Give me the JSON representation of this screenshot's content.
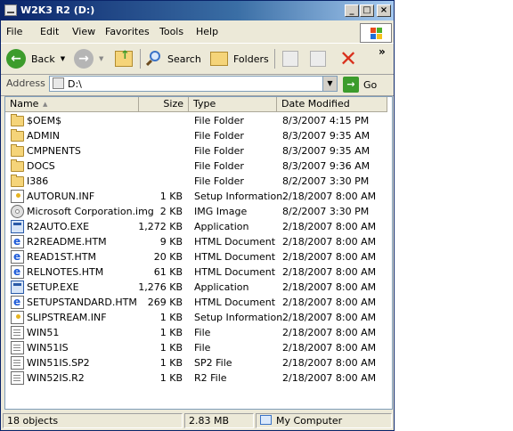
{
  "window": {
    "title": "W2K3 R2 (D:)"
  },
  "menu": [
    {
      "label": "File"
    },
    {
      "label": "Edit"
    },
    {
      "label": "View"
    },
    {
      "label": "Favorites"
    },
    {
      "label": "Tools"
    },
    {
      "label": "Help"
    }
  ],
  "toolbar": {
    "back": "Back",
    "search": "Search",
    "folders": "Folders",
    "overflow": "»"
  },
  "address": {
    "label": "Address",
    "value": "D:\\",
    "go": "Go"
  },
  "columns": {
    "name": "Name",
    "size": "Size",
    "type": "Type",
    "date": "Date Modified"
  },
  "files": [
    {
      "name": "$OEM$",
      "size": "",
      "type": "File Folder",
      "date": "8/3/2007 4:15 PM",
      "icon": "folder-icon"
    },
    {
      "name": "ADMIN",
      "size": "",
      "type": "File Folder",
      "date": "8/3/2007 9:35 AM",
      "icon": "folder-icon"
    },
    {
      "name": "CMPNENTS",
      "size": "",
      "type": "File Folder",
      "date": "8/3/2007 9:35 AM",
      "icon": "folder-icon"
    },
    {
      "name": "DOCS",
      "size": "",
      "type": "File Folder",
      "date": "8/3/2007 9:36 AM",
      "icon": "folder-icon"
    },
    {
      "name": "I386",
      "size": "",
      "type": "File Folder",
      "date": "8/2/2007 3:30 PM",
      "icon": "folder-icon"
    },
    {
      "name": "AUTORUN.INF",
      "size": "1 KB",
      "type": "Setup Information",
      "date": "2/18/2007 8:00 AM",
      "icon": "setup-info-icon"
    },
    {
      "name": "Microsoft Corporation.img",
      "size": "2 KB",
      "type": "IMG Image",
      "date": "8/2/2007 3:30 PM",
      "icon": "disc-image-icon"
    },
    {
      "name": "R2AUTO.EXE",
      "size": "1,272 KB",
      "type": "Application",
      "date": "2/18/2007 8:00 AM",
      "icon": "application-icon"
    },
    {
      "name": "R2README.HTM",
      "size": "9 KB",
      "type": "HTML Document",
      "date": "2/18/2007 8:00 AM",
      "icon": "html-document-icon"
    },
    {
      "name": "READ1ST.HTM",
      "size": "20 KB",
      "type": "HTML Document",
      "date": "2/18/2007 8:00 AM",
      "icon": "html-document-icon"
    },
    {
      "name": "RELNOTES.HTM",
      "size": "61 KB",
      "type": "HTML Document",
      "date": "2/18/2007 8:00 AM",
      "icon": "html-document-icon"
    },
    {
      "name": "SETUP.EXE",
      "size": "1,276 KB",
      "type": "Application",
      "date": "2/18/2007 8:00 AM",
      "icon": "application-icon"
    },
    {
      "name": "SETUPSTANDARD.HTM",
      "size": "269 KB",
      "type": "HTML Document",
      "date": "2/18/2007 8:00 AM",
      "icon": "html-document-icon"
    },
    {
      "name": "SLIPSTREAM.INF",
      "size": "1 KB",
      "type": "Setup Information",
      "date": "2/18/2007 8:00 AM",
      "icon": "setup-info-icon"
    },
    {
      "name": "WIN51",
      "size": "1 KB",
      "type": "File",
      "date": "2/18/2007 8:00 AM",
      "icon": "file-icon"
    },
    {
      "name": "WIN51IS",
      "size": "1 KB",
      "type": "File",
      "date": "2/18/2007 8:00 AM",
      "icon": "file-icon"
    },
    {
      "name": "WIN51IS.SP2",
      "size": "1 KB",
      "type": "SP2 File",
      "date": "2/18/2007 8:00 AM",
      "icon": "file-icon"
    },
    {
      "name": "WIN52IS.R2",
      "size": "1 KB",
      "type": "R2 File",
      "date": "2/18/2007 8:00 AM",
      "icon": "file-icon"
    }
  ],
  "status": {
    "count": "18 objects",
    "size": "2.83 MB",
    "zone": "My Computer"
  }
}
